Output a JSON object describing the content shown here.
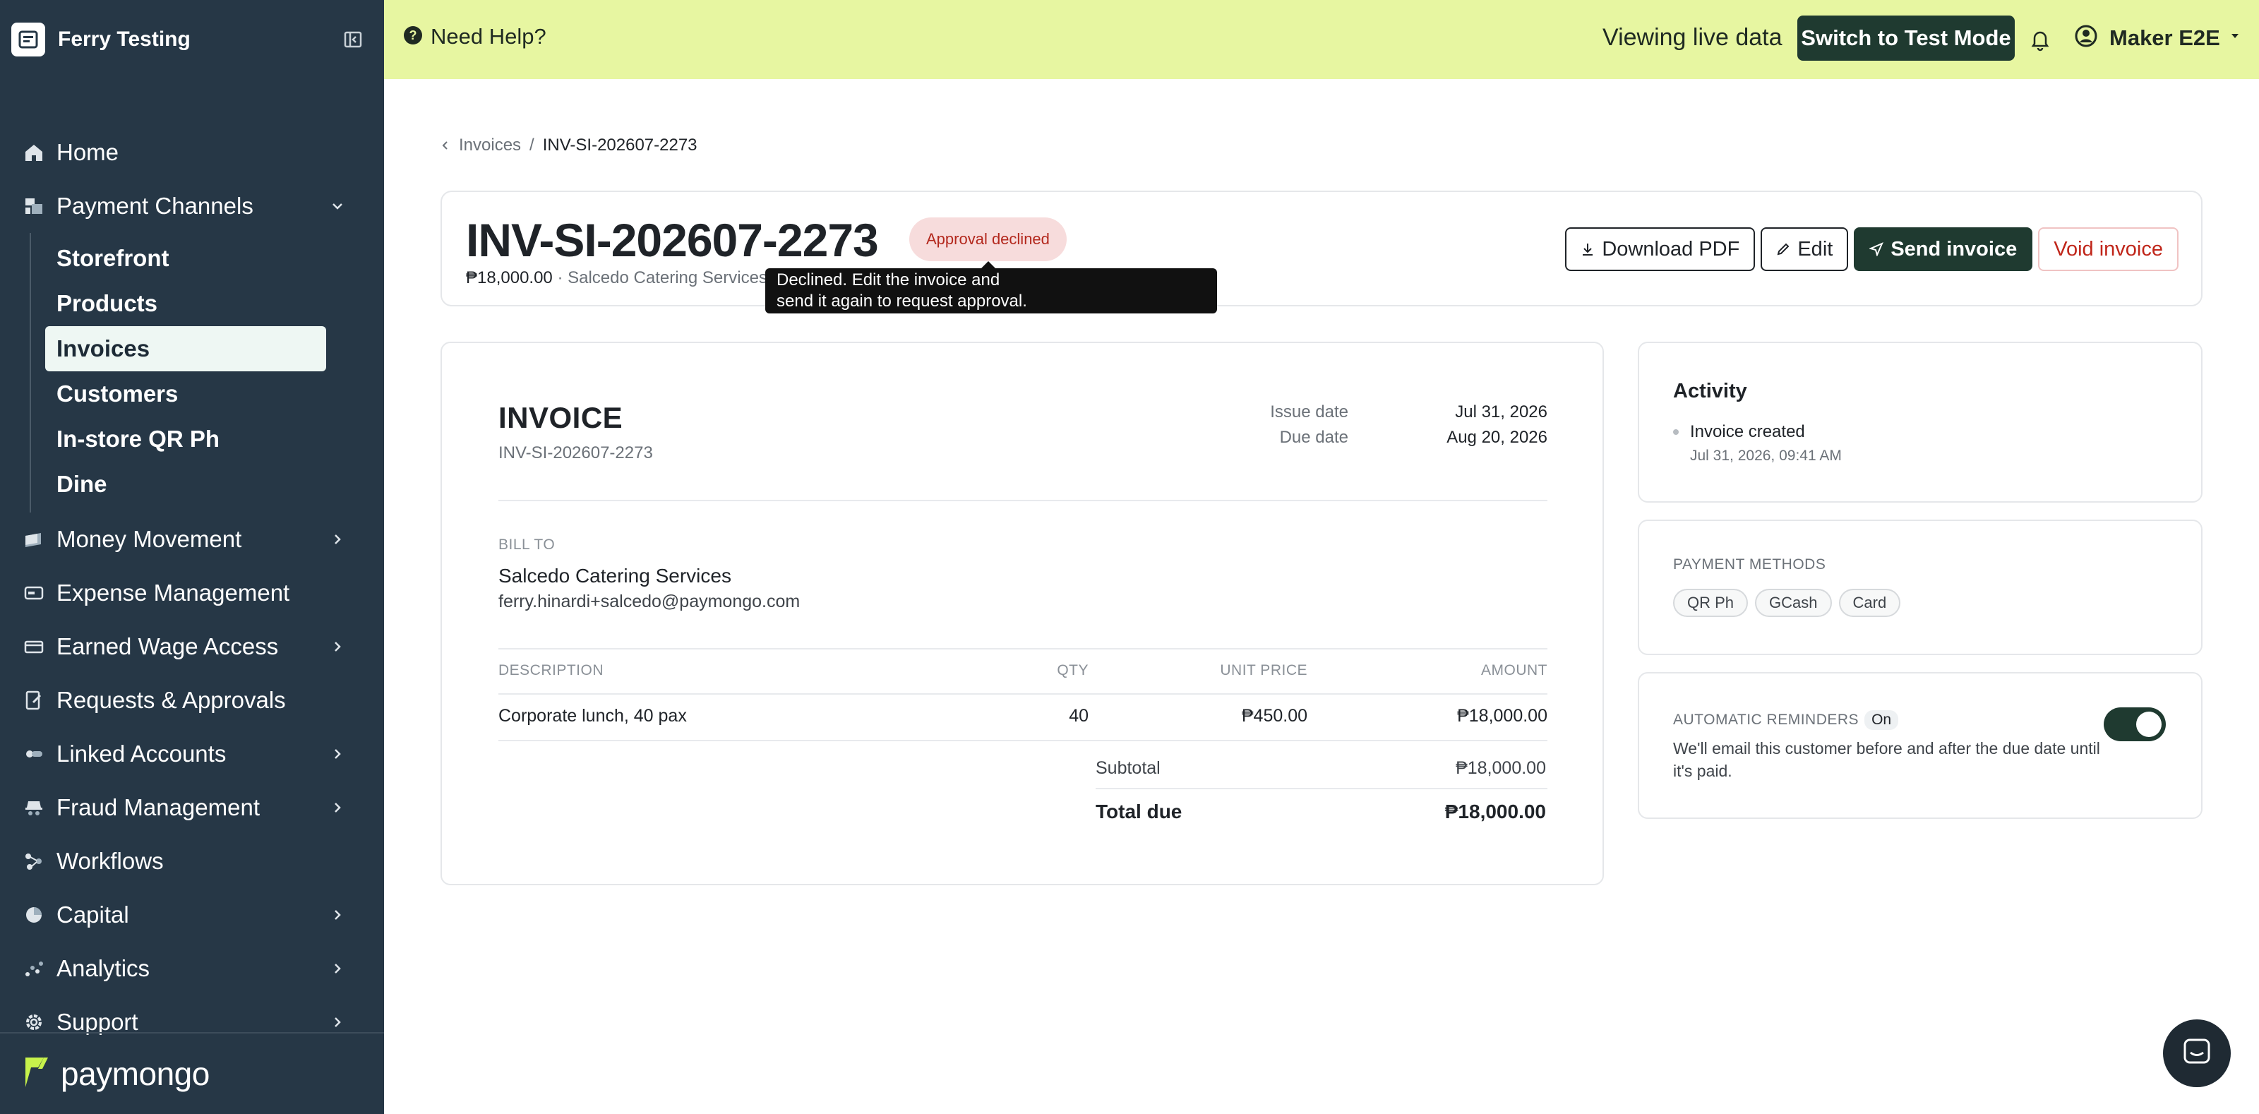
{
  "app": {
    "workspace_name": "Ferry Testing",
    "brand_word": "paymongo"
  },
  "sidebar": {
    "items": [
      {
        "label": "Home"
      },
      {
        "label": "Payment Channels"
      },
      {
        "label": "Money Movement"
      },
      {
        "label": "Expense Management"
      },
      {
        "label": "Earned Wage Access"
      },
      {
        "label": "Requests & Approvals"
      },
      {
        "label": "Linked Accounts"
      },
      {
        "label": "Fraud Management"
      },
      {
        "label": "Workflows"
      },
      {
        "label": "Capital"
      },
      {
        "label": "Analytics"
      },
      {
        "label": "Support"
      }
    ],
    "payment_channels_sub": [
      {
        "label": "Storefront"
      },
      {
        "label": "Products"
      },
      {
        "label": "Invoices"
      },
      {
        "label": "Customers"
      },
      {
        "label": "In-store QR Ph"
      },
      {
        "label": "Dine"
      }
    ]
  },
  "topbar": {
    "help": "Need Help?",
    "live_status": "Viewing live data",
    "test_mode_button": "Switch to Test Mode",
    "user_name": "Maker E2E"
  },
  "breadcrumb": {
    "parent": "Invoices",
    "sep": "/",
    "current": "INV-SI-202607-2273"
  },
  "header": {
    "invoice_id": "INV-SI-202607-2273",
    "status": "Approval declined",
    "amount": "₱18,000.00",
    "customer": "· Salcedo Catering Services",
    "tooltip_line1": "Declined. Edit the invoice and",
    "tooltip_line2": "send it again to request approval.",
    "actions": {
      "download": "Download PDF",
      "edit": "Edit",
      "send": "Send invoice",
      "void": "Void invoice"
    }
  },
  "invoice": {
    "heading": "INVOICE",
    "number": "INV-SI-202607-2273",
    "issue_label": "Issue date",
    "issue_date": "Jul 31, 2026",
    "due_label": "Due date",
    "due_date": "Aug 20, 2026",
    "bill_to_label": "BILL TO",
    "bill_name": "Salcedo Catering Services",
    "bill_email": "ferry.hinardi+salcedo@paymongo.com",
    "columns": {
      "description": "DESCRIPTION",
      "qty": "QTY",
      "unit_price": "UNIT PRICE",
      "amount": "AMOUNT"
    },
    "rows": [
      {
        "description": "Corporate lunch, 40 pax",
        "qty": "40",
        "unit_price": "₱450.00",
        "amount": "₱18,000.00"
      }
    ],
    "subtotal_label": "Subtotal",
    "subtotal": "₱18,000.00",
    "total_label": "Total due",
    "total": "₱18,000.00"
  },
  "activity": {
    "title": "Activity",
    "items": [
      {
        "event": "Invoice created",
        "time": "Jul 31, 2026, 09:41 AM"
      }
    ]
  },
  "payment_methods": {
    "label": "PAYMENT METHODS",
    "chips": [
      "QR Ph",
      "GCash",
      "Card"
    ]
  },
  "reminders": {
    "label": "AUTOMATIC REMINDERS",
    "state": "On",
    "description": "We'll email this customer before and after the due date until it's paid.",
    "enabled": true
  }
}
